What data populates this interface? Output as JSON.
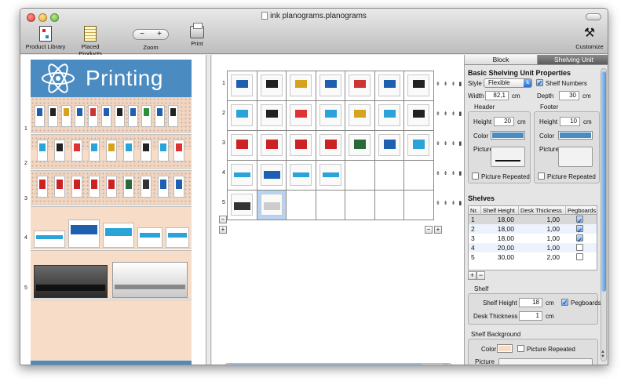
{
  "window": {
    "title": "ink planograms.planograms"
  },
  "toolbar": {
    "product_library": "Product Library",
    "placed_products": "Placed Products",
    "zoom": "Zoom",
    "zoom_minus": "−",
    "zoom_plus": "+",
    "print": "Print",
    "customize": "Customize"
  },
  "preview": {
    "banner_text": "Printing",
    "row_numbers": [
      "1",
      "2",
      "3",
      "4",
      "5"
    ],
    "colors": {
      "banner": "#4a8cc2",
      "background": "#f7dcc7"
    }
  },
  "grid": {
    "row_numbers": [
      "1",
      "2",
      "3",
      "4",
      "5"
    ],
    "add_label": "+",
    "remove_label": "−"
  },
  "inspector": {
    "tabs": {
      "block": "Block",
      "shelving_unit": "Shelving Unit"
    },
    "basic": {
      "title": "Basic Shelving Unit Properties",
      "style_label": "Style",
      "style_value": "Flexible",
      "shelf_numbers_label": "Shelf Numbers",
      "shelf_numbers_checked": true,
      "width_label": "Width",
      "width_value": "82,1",
      "width_unit": "cm",
      "depth_label": "Depth",
      "depth_value": "30",
      "depth_unit": "cm"
    },
    "header": {
      "title": "Header",
      "height_label": "Height",
      "height_value": "20",
      "height_unit": "cm",
      "color_label": "Color",
      "color": "#4a8cc2",
      "picture_label": "Picture",
      "picture_repeated_label": "Picture Repeated"
    },
    "footer": {
      "title": "Footer",
      "height_label": "Height",
      "height_value": "10",
      "height_unit": "cm",
      "color_label": "Color",
      "color": "#4a8cc2",
      "picture_label": "Picture",
      "picture_repeated_label": "Picture Repeated"
    },
    "shelves": {
      "title": "Shelves",
      "columns": [
        "Nr.",
        "Shelf Height",
        "Desk Thickness",
        "Pegboards"
      ],
      "rows": [
        {
          "nr": "1",
          "height": "18,00",
          "thickness": "1,00",
          "pegboards": true
        },
        {
          "nr": "2",
          "height": "18,00",
          "thickness": "1,00",
          "pegboards": true
        },
        {
          "nr": "3",
          "height": "18,00",
          "thickness": "1,00",
          "pegboards": true
        },
        {
          "nr": "4",
          "height": "20,00",
          "thickness": "1,00",
          "pegboards": false
        },
        {
          "nr": "5",
          "height": "30,00",
          "thickness": "2,00",
          "pegboards": false
        }
      ]
    },
    "shelf": {
      "title": "Shelf",
      "height_label": "Shelf Height",
      "height_value": "18",
      "height_unit": "cm",
      "pegboards_label": "Pegboards",
      "pegboards_checked": true,
      "thickness_label": "Desk Thickness",
      "thickness_value": "1",
      "thickness_unit": "cm"
    },
    "shelf_background": {
      "title": "Shelf Background",
      "color_label": "Color",
      "color": "#f7dcc7",
      "picture_repeated_label": "Picture Repeated",
      "picture_label": "Picture"
    }
  }
}
